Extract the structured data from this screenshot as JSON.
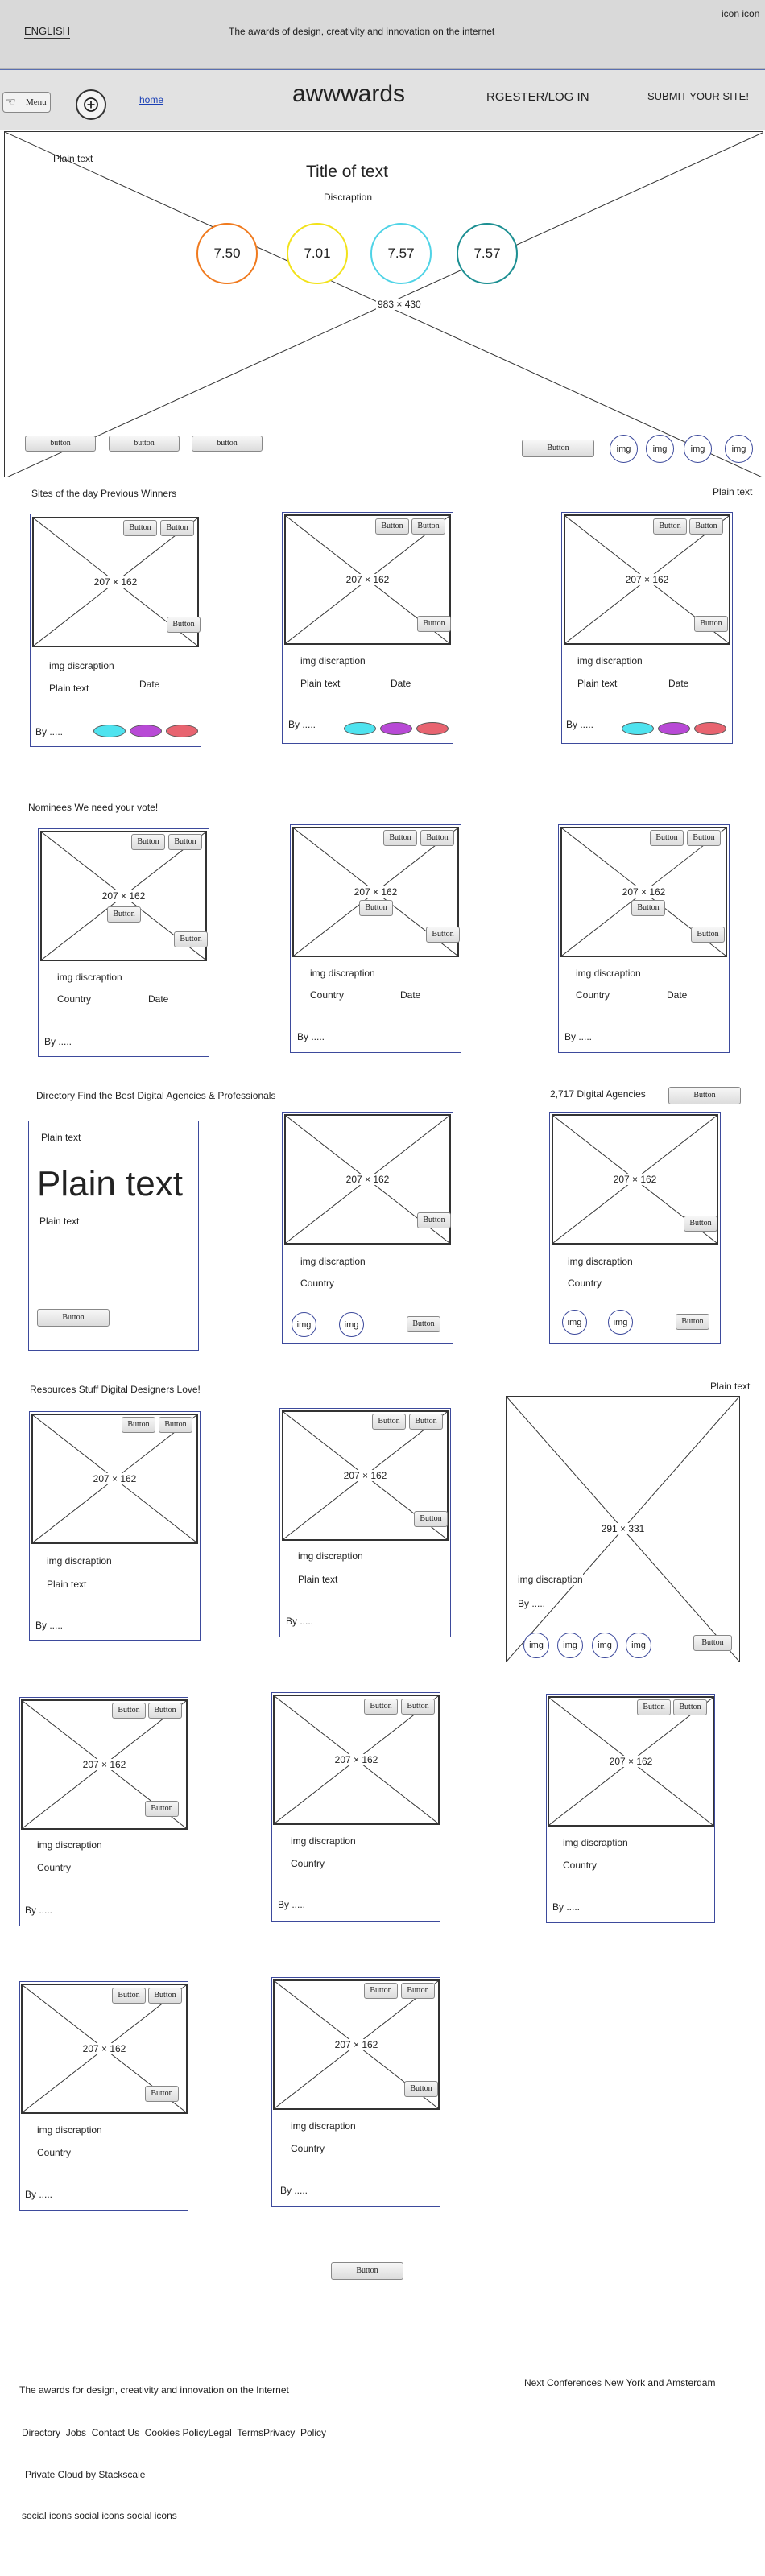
{
  "topbar": {
    "language": "ENGLISH",
    "tagline": "The awards of design, creativity and innovation on the internet",
    "icons": "icon icon"
  },
  "nav": {
    "menu": "Menu",
    "home": "home",
    "logo": "awwwards",
    "register_login": "RGESTER/LOG IN",
    "submit": "SUBMIT YOUR SITE!"
  },
  "hero": {
    "plain_text": "Plain text",
    "title": "Title of text",
    "description": "Discraption",
    "scores": [
      {
        "value": "7.50",
        "color": "#f07a1e"
      },
      {
        "value": "7.01",
        "color": "#f2e21a"
      },
      {
        "value": "7.57",
        "color": "#4fd3e6"
      },
      {
        "value": "7.57",
        "color": "#1c8f92"
      }
    ],
    "size_label": "983 × 430",
    "small_buttons": [
      "button",
      "button",
      "button"
    ],
    "button": "Button",
    "img_labels": [
      "img",
      "img",
      "img",
      "img"
    ]
  },
  "section1": {
    "heading": "Sites of the day Previous Winners",
    "right_text": "Plain text",
    "cards": [
      {
        "size": "207 × 162",
        "desc": "img discraption",
        "plain": "Plain text",
        "date": "Date",
        "by": "By .....",
        "btn": "Button"
      },
      {
        "size": "207 × 162",
        "desc": "img discraption",
        "plain": "Plain text",
        "date": "Date",
        "by": "By .....",
        "btn": "Button"
      },
      {
        "size": "207 × 162",
        "desc": "img discraption",
        "plain": "Plain text",
        "date": "Date",
        "by": "By .....",
        "btn": "Button"
      }
    ],
    "oval_colors": [
      "#4fe3ef",
      "#b84ad6",
      "#e86470"
    ]
  },
  "section2": {
    "heading": "Nominees We need your vote!",
    "cards": [
      {
        "size": "207 × 162",
        "desc": "img discraption",
        "country": "Country",
        "date": "Date",
        "by": "By .....",
        "btn": "Button"
      },
      {
        "size": "207 × 162",
        "desc": "img discraption",
        "country": "Country",
        "date": "Date",
        "by": "By .....",
        "btn": "Button"
      },
      {
        "size": "207 × 162",
        "desc": "img discraption",
        "country": "Country",
        "date": "Date",
        "by": "By .....",
        "btn": "Button"
      }
    ]
  },
  "section3": {
    "heading": "Directory Find the Best Digital Agencies & Professionals",
    "count": "2,717 Digital Agencies",
    "button": "Button",
    "promo": {
      "small": "Plain text",
      "big": "Plain text",
      "small2": "Plain text",
      "btn": "Button"
    },
    "cards": [
      {
        "size": "207 × 162",
        "desc": "img discraption",
        "country": "Country",
        "img": "img",
        "btn": "Button"
      },
      {
        "size": "207 × 162",
        "desc": "img discraption",
        "country": "Country",
        "img": "img",
        "btn": "Button"
      }
    ]
  },
  "section4": {
    "heading": "Resources  Stuff Digital Designers Love!",
    "right_text": "Plain text",
    "cards": [
      {
        "size": "207 × 162",
        "desc": "img discraption",
        "plain": "Plain text",
        "by": "By .....",
        "btn": "Button"
      },
      {
        "size": "207 × 162",
        "desc": "img discraption",
        "plain": "Plain text",
        "by": "By .....",
        "btn": "Button"
      }
    ],
    "large": {
      "size": "291 × 331",
      "desc": "img discraption",
      "by": "By .....",
      "img": "img",
      "btn": "Button"
    }
  },
  "grid": {
    "cards": [
      {
        "size": "207 × 162",
        "desc": "img discraption",
        "country": "Country",
        "by": "By .....",
        "btn": "Button"
      },
      {
        "size": "207 × 162",
        "desc": "img discraption",
        "country": "Country",
        "by": "By .....",
        "btn": "Button"
      },
      {
        "size": "207 × 162",
        "desc": "img discraption",
        "country": "Country",
        "by": "By .....",
        "btn": "Button"
      },
      {
        "size": "207 × 162",
        "desc": "img discraption",
        "country": "Country",
        "by": "By .....",
        "btn": "Button"
      },
      {
        "size": "207 × 162",
        "desc": "img discraption",
        "country": "Country",
        "by": "By .....",
        "btn": "Button"
      }
    ],
    "more_button": "Button"
  },
  "footer": {
    "tagline": "The awards for design, creativity and innovation on the Internet",
    "conferences": "Next Conferences  New York and Amsterdam",
    "links": [
      "Directory",
      "Jobs",
      "Contact Us",
      "Cookies",
      "PolicyLegal",
      "TermsPrivacy",
      "Policy"
    ],
    "hosting": "Private Cloud by Stackscale",
    "social": "social icons social icons social icons"
  }
}
